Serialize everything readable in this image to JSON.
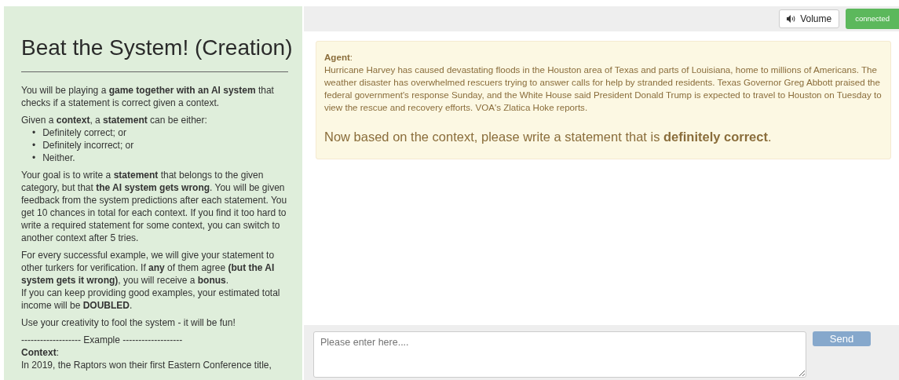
{
  "instructions": {
    "title": "Beat the System! (Creation)",
    "intro": "You will be playing a **game together with an AI system** that checks if a statement is correct given a context.",
    "given": "Given a **context**, a **statement** can be either:",
    "options": [
      {
        "marker": "•",
        "text": "Definitely correct; or"
      },
      {
        "marker": "•",
        "text": "Definitely incorrect; or"
      },
      {
        "marker": "•",
        "text": "Neither."
      }
    ],
    "goal": "Your goal is to write a **statement** that belongs to the given category, but that **the AI system gets wrong**. You will be given feedback from the system predictions after each statement. You get 10 chances in total for each context. If you find it too hard to write a required statement for some context, you can switch to another context after 5 tries.",
    "bonus": "For every successful example, we will give your statement to other turkers for verification. If **any** of them agree **(but the AI system gets it wrong)**, you will receive a **bonus**.",
    "doubled": "If you can keep providing good examples, your estimated total income will be **DOUBLED**.",
    "fun": "Use your creativity to fool the system - it will be fun!",
    "example_divider": "------------------- Example -------------------",
    "context_label": "**Context**:",
    "context_text": "In 2019, the Raptors won their first Eastern Conference title,"
  },
  "toolbar": {
    "volume": "Volume",
    "status": "connected"
  },
  "message": {
    "sender": "**Agent**:",
    "context": "Hurricane Harvey has caused devastating floods in the Houston area of Texas and parts of Louisiana, home to millions of Americans. The weather disaster has overwhelmed rescuers trying to answer calls for help by stranded residents. Texas Governor Greg Abbott praised the federal government's response Sunday, and the White House said President Donald Trump is expected to travel to Houston on Tuesday to view the rescue and recovery efforts. VOA's Zlatica Hoke reports.",
    "prompt": "Now based on the context, please write a statement that is **definitely correct**."
  },
  "composer": {
    "placeholder": "Please enter here....",
    "send": "Send",
    "send_disabled": true
  }
}
